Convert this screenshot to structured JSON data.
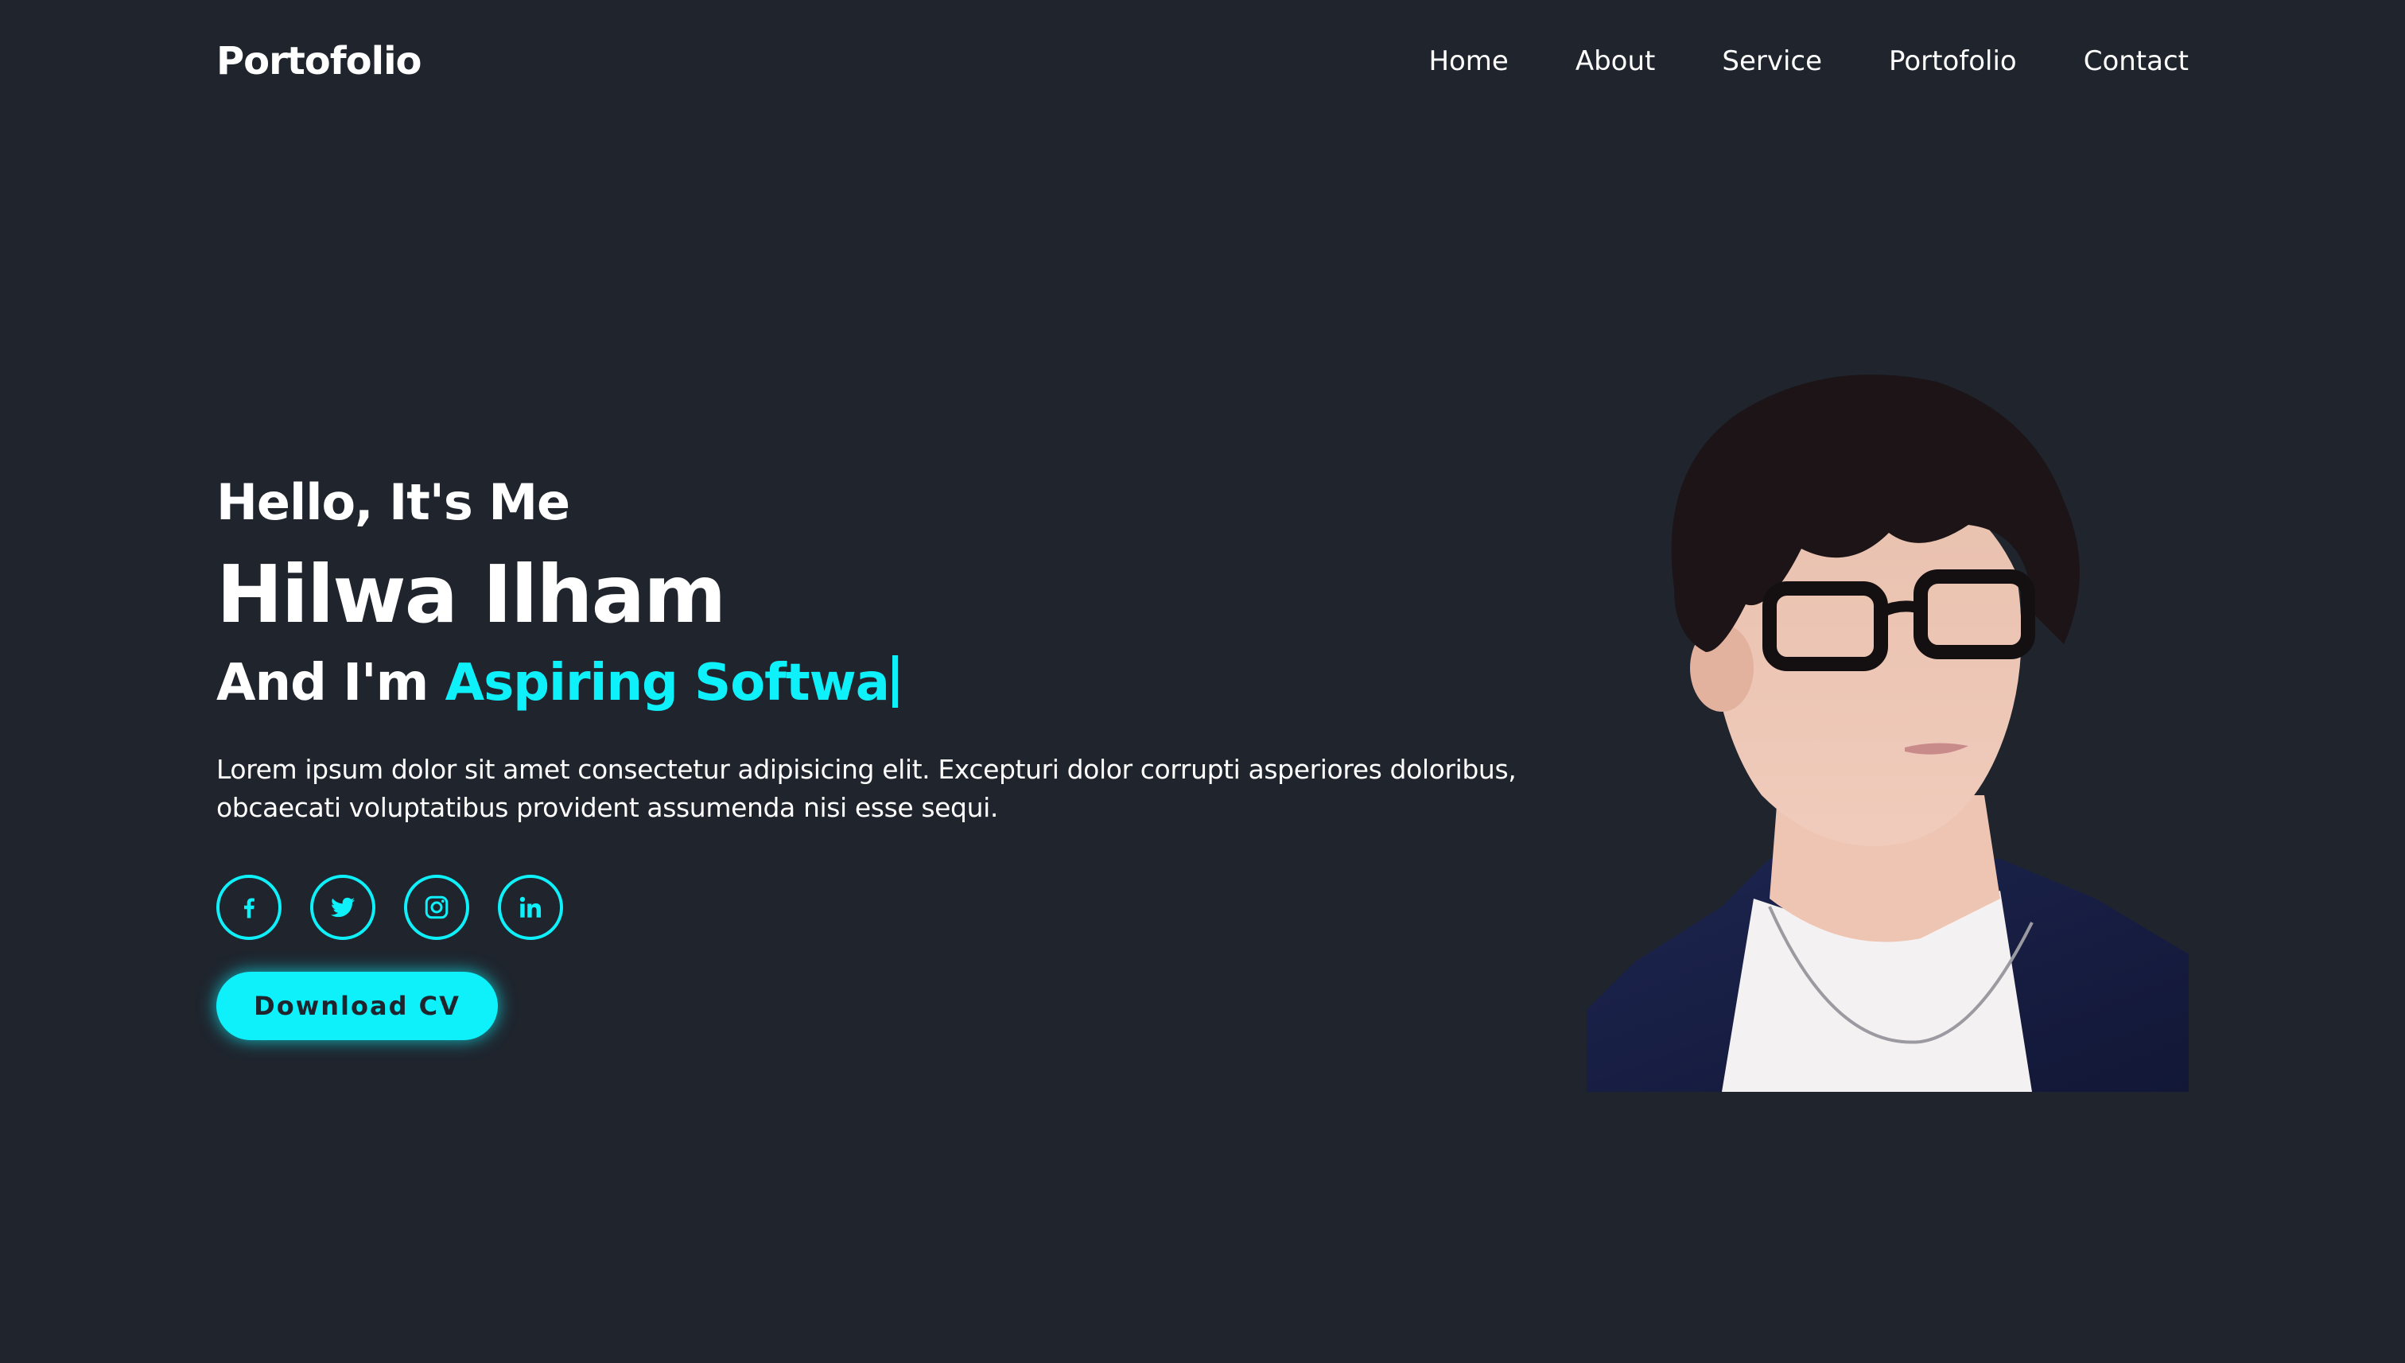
{
  "header": {
    "logo": "Portofolio",
    "nav": [
      "Home",
      "About",
      "Service",
      "Portofolio",
      "Contact"
    ]
  },
  "hero": {
    "greeting": "Hello, It's Me",
    "name": "Hilwa Ilham",
    "role_prefix": "And I'm",
    "role_typed": "Aspiring Softwa",
    "description": "Lorem ipsum dolor sit amet consectetur adipisicing elit. Excepturi dolor corrupti asperiores doloribus, obcaecati voluptatibus provident assumenda nisi esse sequi.",
    "socials": [
      {
        "icon": "facebook-icon"
      },
      {
        "icon": "twitter-icon"
      },
      {
        "icon": "instagram-icon"
      },
      {
        "icon": "linkedin-icon"
      }
    ],
    "cta_label": "Download CV"
  },
  "colors": {
    "background": "#1f242d",
    "accent": "#0ef0fa",
    "text": "#ffffff"
  }
}
